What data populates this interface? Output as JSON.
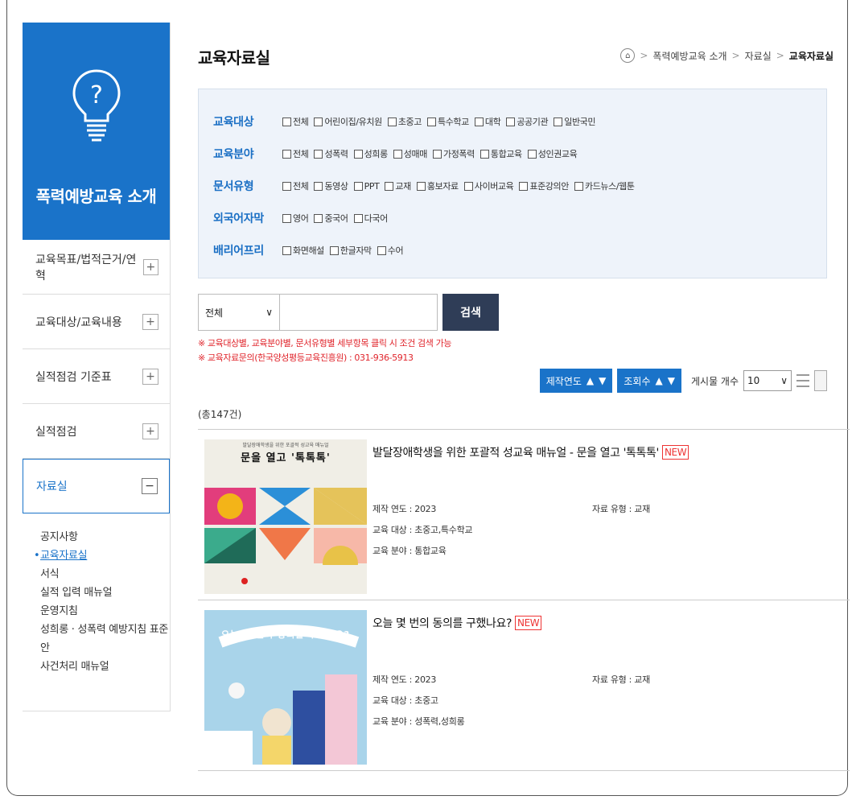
{
  "sidebar": {
    "hero_title": "폭력예방교육 소개",
    "menu": [
      {
        "label": "교육목표/법적근거/연혁",
        "toggle": "+"
      },
      {
        "label": "교육대상/교육내용",
        "toggle": "+"
      },
      {
        "label": "실적점검 기준표",
        "toggle": "+"
      },
      {
        "label": "실적점검",
        "toggle": "+"
      },
      {
        "label": "자료실",
        "toggle": "−"
      }
    ],
    "submenu": [
      "공지사항",
      "교육자료실",
      "서식",
      "실적 입력 매뉴얼",
      "운영지침",
      "성희롱 · 성폭력 예방지침 표준안",
      "사건처리 매뉴얼"
    ]
  },
  "header": {
    "title": "교육자료실",
    "breadcrumb": [
      "폭력예방교육 소개",
      "자료실",
      "교육자료실"
    ],
    "sep": ">"
  },
  "filters": [
    {
      "label": "교육대상",
      "options": [
        "전체",
        "어린이집/유치원",
        "초중고",
        "특수학교",
        "대학",
        "공공기관",
        "일반국민"
      ]
    },
    {
      "label": "교육분야",
      "options": [
        "전체",
        "성폭력",
        "성희롱",
        "성매매",
        "가정폭력",
        "통합교육",
        "성인권교육"
      ]
    },
    {
      "label": "문서유형",
      "options": [
        "전체",
        "동영상",
        "PPT",
        "교재",
        "홍보자료",
        "사이버교육",
        "표준강의안",
        "카드뉴스/웹툰"
      ]
    },
    {
      "label": "외국어자막",
      "options": [
        "영어",
        "중국어",
        "다국어"
      ]
    },
    {
      "label": "배리어프리",
      "options": [
        "화면해설",
        "한글자막",
        "수어"
      ]
    }
  ],
  "search": {
    "select_value": "전체",
    "select_arrow": "∨",
    "button": "검색",
    "notes": [
      "※ 교육대상별, 교육분야별, 문서유형별 세부항목 클릭 시 조건 검색 가능",
      "※ 교육자료문의(한국양성평등교육진흥원) : 031-936-5913"
    ]
  },
  "sort": {
    "year_label": "제작연도",
    "views_label": "조회수",
    "up": "▲",
    "down": "▼",
    "count_label": "게시물 개수",
    "count_value": "10",
    "count_arrow": "∨"
  },
  "total": "(총147건)",
  "items": [
    {
      "title": "발달장애학생을 위한 포괄적 성교육 매뉴얼 - 문을 열고 '톡톡톡'",
      "badge": "NEW",
      "cover_sub": "발달장애학생을 위한 포괄적 성교육 매뉴얼",
      "cover_title": "문을 열고 '톡톡톡'",
      "year": "제작 연도 : 2023",
      "target": "교육 대상 : 초중고,특수학교",
      "field": "교육 분야 : 통합교육",
      "type": "자료 유형 : 교재"
    },
    {
      "title": "오늘 몇 번의 동의를 구했나요?",
      "badge": "NEW",
      "cover_title": "오늘 몇 번의 동의를 구했나요?",
      "year": "제작 연도 : 2023",
      "target": "교육 대상 : 초중고",
      "field": "교육 분야 : 성폭력,성희롱",
      "type": "자료 유형 : 교재"
    }
  ],
  "colors": {
    "primary": "#1a73c9",
    "dark_button": "#2f3d57",
    "notice": "#e0242b",
    "filter_bg": "#eef3fa"
  }
}
